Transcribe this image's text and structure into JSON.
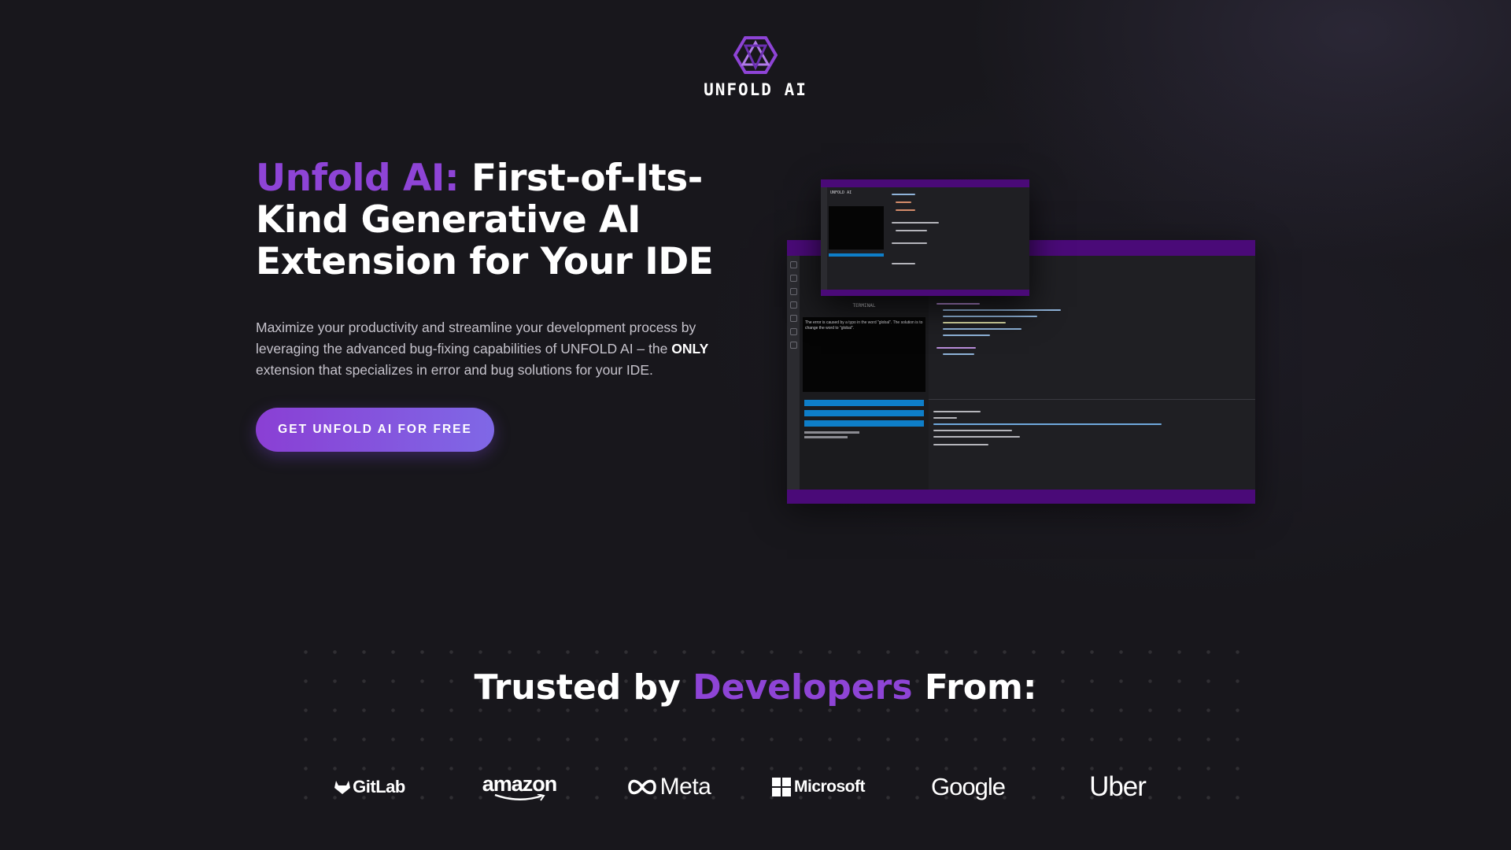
{
  "header": {
    "logo_text": "UNFOLD AI",
    "logo_icon": "hexagon-triangles-icon",
    "accent_color": "#8e44d6"
  },
  "hero": {
    "title_accent": "Unfold AI:",
    "title_line1_rest": " First-of-Its-",
    "title_line2": "Kind Generative AI",
    "title_line3": "Extension for Your IDE",
    "desc_part1": "Maximize your productivity and streamline your development process by leveraging the advanced bug-fixing capabilities of UNFOLD AI – the ",
    "desc_strong": "ONLY",
    "desc_part2": " extension that specializes in error and bug solutions for your IDE.",
    "cta_label": "GET UNFOLD AI FOR FREE"
  },
  "screenshot": {
    "panel_title": "TERMINAL",
    "panel_text": "The error is caused by a typo in the word \"global\". The solution is to change the word to \"global\".",
    "small_title": "UNFOLD AI"
  },
  "trusted": {
    "title_part1": "Trusted by ",
    "title_accent": "Developers",
    "title_part2": " From:",
    "logos": {
      "gitlab": "GitLab",
      "amazon": "amazon",
      "meta": "Meta",
      "microsoft": "Microsoft",
      "google": "Google",
      "uber": "Uber"
    }
  }
}
